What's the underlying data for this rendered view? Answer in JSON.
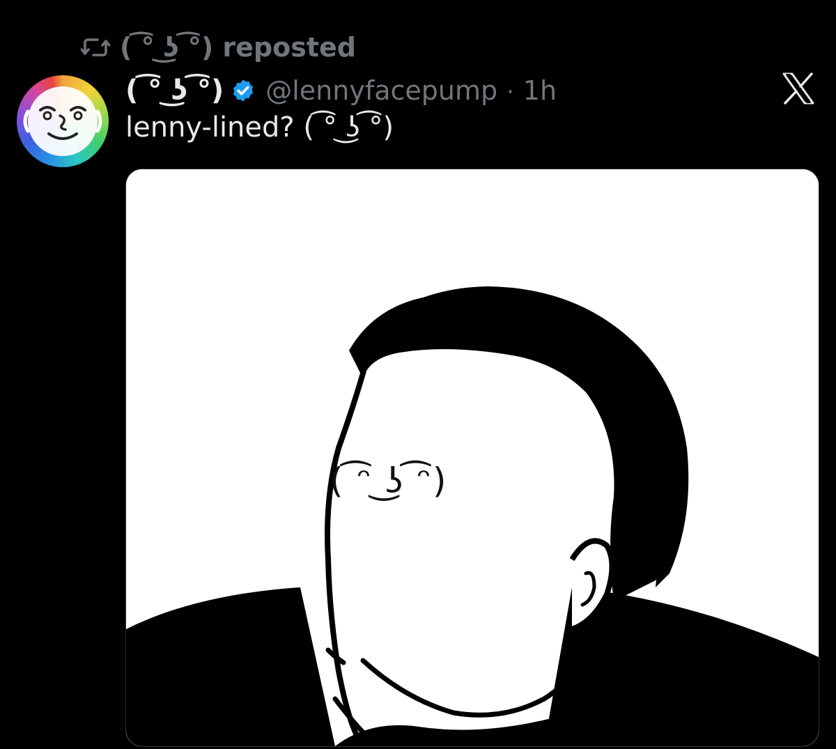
{
  "repost": {
    "icon": "repost-icon",
    "text": "( ͡° ͜ʖ ͡°) reposted"
  },
  "author": {
    "display_name": "( ͡° ͜ʖ ͡°)",
    "verified_icon": "verified-badge-icon",
    "verified_color": "#1d9bf0",
    "handle": "@lennyfacepump",
    "separator": "·",
    "time": "1h"
  },
  "avatar": {
    "icon": "rainbow-lenny-avatar",
    "face": "( ͡° ͜ʖ ͡°)"
  },
  "brand": {
    "logo": "x-logo-icon"
  },
  "tweet": {
    "text": "lenny-lined? ( ͡° ͜ʖ ͡°)"
  },
  "media": {
    "type": "image",
    "description_icon": "meme-face-image",
    "overlay_text": "( ͡ᵔ ͜ʖ ͡ᵔ)"
  },
  "colors": {
    "background": "#000000",
    "primary_text": "#e7e9ea",
    "secondary_text": "#71767b",
    "accent": "#1d9bf0"
  }
}
